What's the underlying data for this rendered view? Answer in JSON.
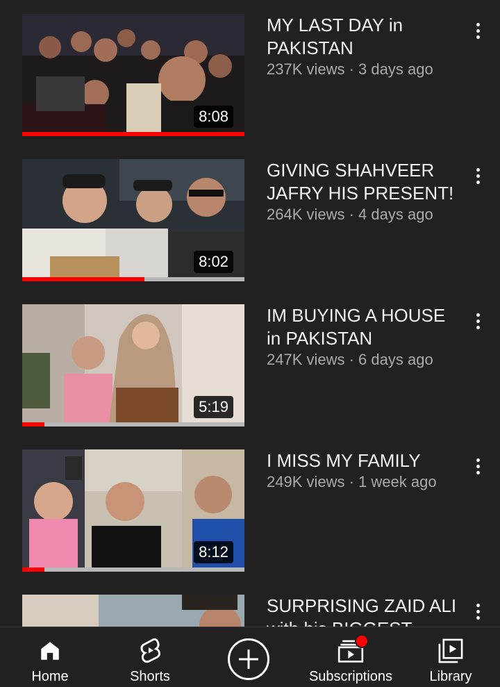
{
  "videos": [
    {
      "title": "MY LAST DAY in PAKISTAN",
      "meta": "237K views · 3 days ago",
      "duration": "8:08",
      "progress": 1.0
    },
    {
      "title": "GIVING SHAHVEER JAFRY HIS PRESENT!",
      "meta": "264K views · 4 days ago",
      "duration": "8:02",
      "progress": 0.55
    },
    {
      "title": "IM BUYING A HOUSE in PAKISTAN",
      "meta": "247K views · 6 days ago",
      "duration": "5:19",
      "progress": 0.1
    },
    {
      "title": "I MISS MY FAMILY",
      "meta": "249K views · 1 week ago",
      "duration": "8:12",
      "progress": 0.1
    },
    {
      "title": "SURPRISING ZAID ALI with his BIGGEST",
      "meta": "",
      "duration": "",
      "progress": 0
    }
  ],
  "nav": {
    "home": "Home",
    "shorts": "Shorts",
    "subscriptions": "Subscriptions",
    "library": "Library"
  },
  "colors": {
    "accent": "#ff0000",
    "background": "#212121",
    "meta_text": "#aaaaaa"
  }
}
